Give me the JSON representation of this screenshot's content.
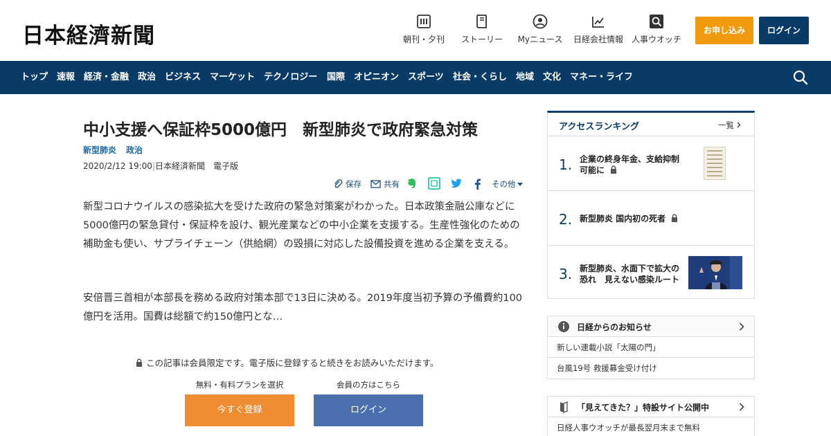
{
  "header": {
    "logo": "日本経濟新聞",
    "utility": [
      {
        "label": "朝刊・夕刊",
        "icon": "newspaper-icon"
      },
      {
        "label": "ストーリー",
        "icon": "book-icon"
      },
      {
        "label": "Myニュース",
        "icon": "user-icon"
      },
      {
        "label": "日経会社情報",
        "icon": "chart-icon"
      },
      {
        "label": "人事ウオッチ",
        "icon": "search-icon"
      }
    ],
    "apply_label": "お申し込み",
    "login_label": "ログイン"
  },
  "nav": {
    "items": [
      "トップ",
      "速報",
      "経済・金融",
      "政治",
      "ビジネス",
      "マーケット",
      "テクノロジー",
      "国際",
      "オピニオン",
      "スポーツ",
      "社会・くらし",
      "地域",
      "文化",
      "マネー・ライフ"
    ]
  },
  "article": {
    "title": "中小支援へ保証枠5000億円　新型肺炎で政府緊急対策",
    "tags": [
      "新型肺炎",
      "政治"
    ],
    "datetime": "2020/2/12 19:00",
    "source": "日本経済新聞　電子版",
    "share": {
      "save": "保存",
      "share": "共有",
      "more": "その他"
    },
    "paragraphs": [
      "新型コロナウイルスの感染拡大を受けた政府の緊急対策案がわかった。日本政策金融公庫などに5000億円の緊急貸付・保証枠を設け、観光産業などの中小企業を支援する。生産性強化のための補助金も使い、サプライチェーン（供給網）の毀損に対応した設備投資を進める企業を支える。",
      "安倍晋三首相が本部長を務める政府対策本部で13日に決める。2019年度当初予算の予備費約100億円を活用。国費は総額で約150億円とな…"
    ],
    "paywall": {
      "message": "この記事は会員限定です。電子版に登録すると続きをお読みいただけます。",
      "register_caption": "無料・有料プランを選択",
      "register_label": "今すぐ登録",
      "login_caption": "会員の方はこちら",
      "login_label": "ログイン"
    }
  },
  "sidebar": {
    "ranking": {
      "title": "アクセスランキング",
      "more": "一覧",
      "items": [
        {
          "rank": "1.",
          "lines": [
            "企業の終身年金、支給抑制",
            "可能に"
          ],
          "locked": true
        },
        {
          "rank": "2.",
          "lines": [
            "新型肺炎 国内初の死者"
          ],
          "locked": true
        },
        {
          "rank": "3.",
          "lines": [
            "新型肺炎、水面下で拡大の",
            "恐れ　見えない感染ルート"
          ],
          "locked": false
        }
      ]
    },
    "notices": {
      "title": "日経からのお知らせ",
      "items": [
        "新しい連載小説「太陽の門」",
        "台風19号 救援募金受け付け"
      ]
    },
    "promo": {
      "title": "「見えてきた？」特設サイト公開中",
      "items": [
        "日経人事ウオッチが最長翌月末まで無料"
      ]
    }
  },
  "colors": {
    "navy": "#0a3a66",
    "orange": "#f29a0e",
    "register": "#ef8b30",
    "login_blue": "#4a70b0",
    "tag_blue": "#1a6aa8"
  }
}
